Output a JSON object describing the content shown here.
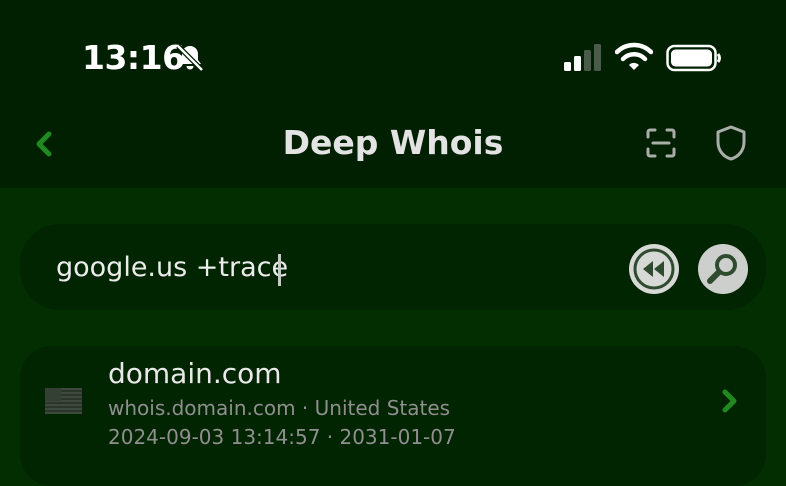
{
  "status_bar": {
    "time": "13:16",
    "icons": [
      "bell-slash-icon",
      "cellular-signal-icon",
      "wifi-icon",
      "battery-icon"
    ]
  },
  "nav": {
    "title": "Deep Whois",
    "icons": [
      "chevron-left-icon",
      "scan-icon",
      "shield-icon"
    ]
  },
  "search": {
    "value": "google.us +trace",
    "buttons": [
      "rewind-icon",
      "magnifier-icon"
    ]
  },
  "results": [
    {
      "flag": "us-flag-icon",
      "domain": "domain.com",
      "server_country": "whois.domain.com · United States",
      "dates": "2024-09-03 13:14:57 · 2031-01-07"
    }
  ],
  "colors": {
    "background": "#022e02",
    "header": "#011f01",
    "accent_green": "#1f8a1f",
    "card": "#012401"
  }
}
